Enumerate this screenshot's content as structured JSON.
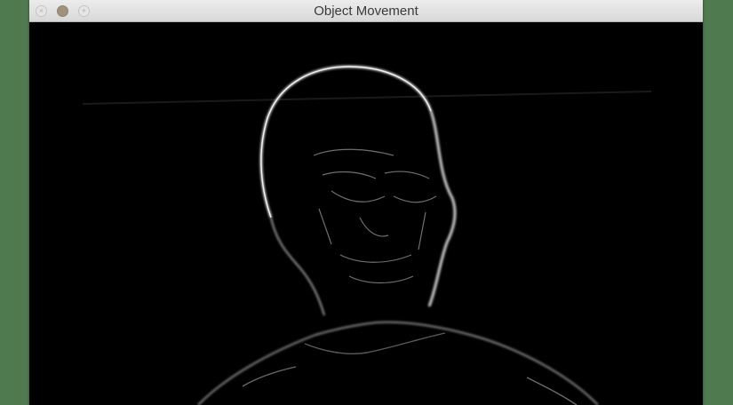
{
  "window": {
    "title": "Object Movement"
  },
  "colors": {
    "desktop_background": "#4f7a50",
    "canvas_background": "#000000",
    "edge_highlight": "#d8d8d8"
  },
  "icons": {
    "close": "close-icon",
    "minimize": "minimize-icon",
    "maximize": "maximize-icon"
  }
}
